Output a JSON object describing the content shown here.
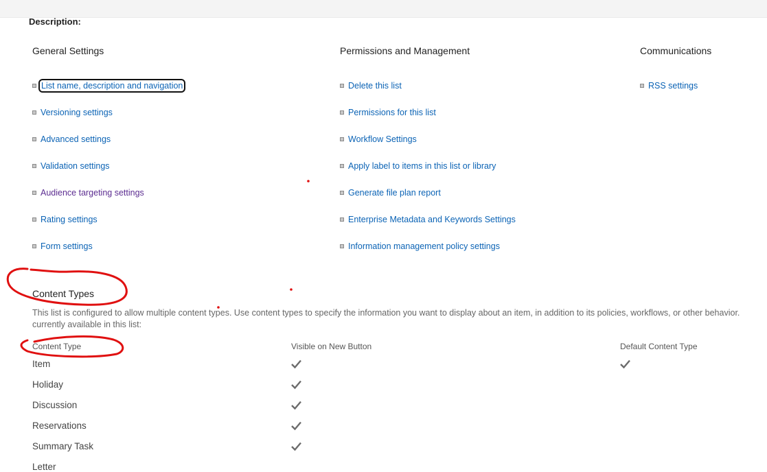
{
  "description_label": "Description:",
  "sections": {
    "general": {
      "title": "General Settings",
      "links": [
        "List name, description and navigation",
        "Versioning settings",
        "Advanced settings",
        "Validation settings",
        "Audience targeting settings",
        "Rating settings",
        "Form settings"
      ]
    },
    "permissions": {
      "title": "Permissions and Management",
      "links": [
        "Delete this list",
        "Permissions for this list",
        "Workflow Settings",
        "Apply label to items in this list or library",
        "Generate file plan report",
        "Enterprise Metadata and Keywords Settings",
        "Information management policy settings"
      ]
    },
    "communications": {
      "title": "Communications",
      "links": [
        "RSS settings"
      ]
    }
  },
  "content_types": {
    "title": "Content Types",
    "description_line1": "This list is configured to allow multiple content types. Use content types to specify the information you want to display about an item, in addition to its policies, workflows, or other behavior.",
    "description_line2": "currently available in this list:",
    "columns": [
      "Content Type",
      "Visible on New Button",
      "Default Content Type"
    ],
    "rows": [
      {
        "name": "Item",
        "visible": true,
        "default": true
      },
      {
        "name": "Holiday",
        "visible": true,
        "default": false
      },
      {
        "name": "Discussion",
        "visible": true,
        "default": false
      },
      {
        "name": "Reservations",
        "visible": true,
        "default": false
      },
      {
        "name": "Summary Task",
        "visible": true,
        "default": false
      },
      {
        "name": "Letter",
        "visible": false,
        "default": false
      }
    ]
  },
  "colors": {
    "link": "#0b63b5",
    "visited_link": "#5c2d91",
    "annotation": "#e01010",
    "check": "#6b6b6b"
  },
  "icons": {
    "bullet": "square-bullet-icon",
    "check": "checkmark-icon"
  }
}
